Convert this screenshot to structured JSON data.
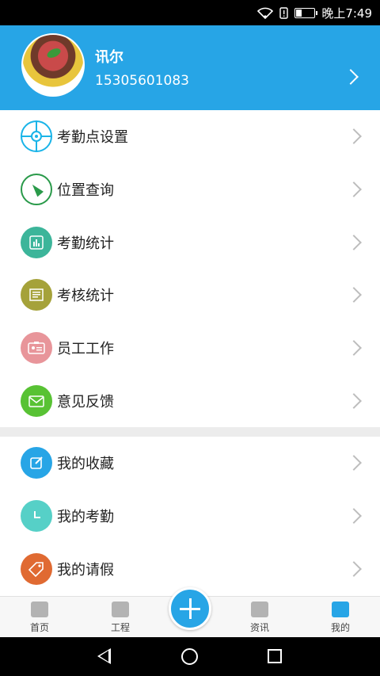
{
  "status_bar": {
    "time": "晚上7:49",
    "battery_level": 0.35
  },
  "profile": {
    "name": "讯尔",
    "phone": "15305601083"
  },
  "menu_group_1": [
    {
      "label": "考勤点设置",
      "icon": "target-icon",
      "color": "#1ab4e8"
    },
    {
      "label": "位置查询",
      "icon": "compass-icon",
      "color": "#2a9a4a"
    },
    {
      "label": "考勤统计",
      "icon": "bar-chart-icon",
      "color": "#3cb59a"
    },
    {
      "label": "考核统计",
      "icon": "document-icon",
      "color": "#a5a23a"
    },
    {
      "label": "员工工作",
      "icon": "id-card-icon",
      "color": "#e8959a"
    },
    {
      "label": "意见反馈",
      "icon": "envelope-icon",
      "color": "#58c234"
    }
  ],
  "menu_group_2": [
    {
      "label": "我的收藏",
      "icon": "edit-icon",
      "color": "#27a5e6"
    },
    {
      "label": "我的考勤",
      "icon": "clock-icon",
      "color": "#56d0c7"
    },
    {
      "label": "我的请假",
      "icon": "tag-icon",
      "color": "#e06a32"
    }
  ],
  "tabbar": {
    "home": "首页",
    "project": "工程",
    "news": "资讯",
    "mine": "我的",
    "active": "mine"
  },
  "colors": {
    "primary": "#27a5e6",
    "separator": "#ececec"
  }
}
